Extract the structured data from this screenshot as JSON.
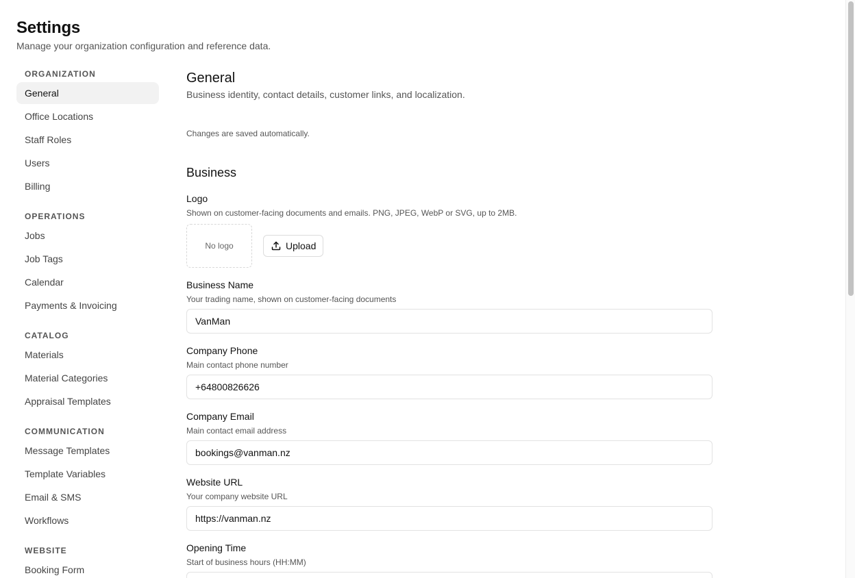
{
  "header": {
    "title": "Settings",
    "subtitle": "Manage your organization configuration and reference data."
  },
  "sidebar": {
    "groups": [
      {
        "label": "ORGANIZATION",
        "items": [
          "General",
          "Office Locations",
          "Staff Roles",
          "Users",
          "Billing"
        ]
      },
      {
        "label": "OPERATIONS",
        "items": [
          "Jobs",
          "Job Tags",
          "Calendar",
          "Payments & Invoicing"
        ]
      },
      {
        "label": "CATALOG",
        "items": [
          "Materials",
          "Material Categories",
          "Appraisal Templates"
        ]
      },
      {
        "label": "COMMUNICATION",
        "items": [
          "Message Templates",
          "Template Variables",
          "Email & SMS",
          "Workflows"
        ]
      },
      {
        "label": "WEBSITE",
        "items": [
          "Booking Form"
        ]
      }
    ],
    "active": "General"
  },
  "main": {
    "title": "General",
    "description": "Business identity, contact details, customer links, and localization.",
    "autosave_note": "Changes are saved automatically.",
    "business": {
      "title": "Business",
      "logo": {
        "label": "Logo",
        "help": "Shown on customer-facing documents and emails. PNG, JPEG, WebP or SVG, up to 2MB.",
        "placeholder": "No logo",
        "upload_label": "Upload"
      },
      "fields": {
        "business_name": {
          "label": "Business Name",
          "help": "Your trading name, shown on customer-facing documents",
          "value": "VanMan"
        },
        "company_phone": {
          "label": "Company Phone",
          "help": "Main contact phone number",
          "value": "+64800826626"
        },
        "company_email": {
          "label": "Company Email",
          "help": "Main contact email address",
          "value": "bookings@vanman.nz"
        },
        "website_url": {
          "label": "Website URL",
          "help": "Your company website URL",
          "value": "https://vanman.nz"
        },
        "opening_time": {
          "label": "Opening Time",
          "help": "Start of business hours (HH:MM)",
          "value": ""
        }
      }
    }
  },
  "colors": {
    "active_nav_bg": "#f2f2f2",
    "border": "#e2e2e2",
    "text_muted": "#555555"
  }
}
